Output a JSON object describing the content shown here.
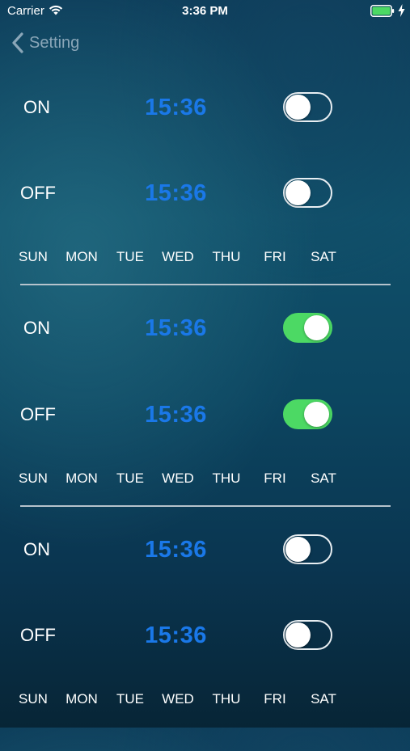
{
  "status_bar": {
    "carrier": "Carrier",
    "time": "3:36 PM",
    "icons": [
      "wifi-icon",
      "battery-icon",
      "charging-bolt-icon"
    ],
    "battery_color": "#4cd964"
  },
  "nav": {
    "back_label": "Setting",
    "back_icon": "chevron-left-icon"
  },
  "colors": {
    "time_text": "#1a78e8",
    "toggle_on": "#4cd964"
  },
  "groups": [
    {
      "on": {
        "label": "ON",
        "time": "15:36",
        "enabled": false
      },
      "off": {
        "label": "OFF",
        "time": "15:36",
        "enabled": false
      },
      "days": [
        "SUN",
        "MON",
        "TUE",
        "WED",
        "THU",
        "FRI",
        "SAT"
      ]
    },
    {
      "on": {
        "label": "ON",
        "time": "15:36",
        "enabled": true
      },
      "off": {
        "label": "OFF",
        "time": "15:36",
        "enabled": true
      },
      "days": [
        "SUN",
        "MON",
        "TUE",
        "WED",
        "THU",
        "FRI",
        "SAT"
      ]
    },
    {
      "on": {
        "label": "ON",
        "time": "15:36",
        "enabled": false
      },
      "off": {
        "label": "OFF",
        "time": "15:36",
        "enabled": false
      },
      "days": [
        "SUN",
        "MON",
        "TUE",
        "WED",
        "THU",
        "FRI",
        "SAT"
      ]
    }
  ]
}
